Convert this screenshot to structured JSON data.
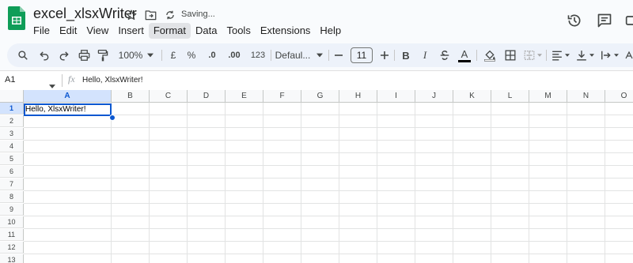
{
  "header": {
    "title": "excel_xlsxWriter",
    "status": "Saving...",
    "icons": [
      "star-icon",
      "move-to-folder-icon",
      "sync-icon",
      "history-icon",
      "comment-icon",
      "video-call-icon"
    ]
  },
  "menu": [
    "File",
    "Edit",
    "View",
    "Insert",
    "Format",
    "Data",
    "Tools",
    "Extensions",
    "Help"
  ],
  "menu_active": "Format",
  "toolbar": {
    "zoom": "100%",
    "currency": "£",
    "percent": "%",
    "decrease_decimal": ".0",
    "increase_decimal": ".00",
    "more_formats": "123",
    "font": "Defaul...",
    "font_size": "11",
    "bold": "B",
    "italic": "I",
    "text_color_letter": "A"
  },
  "formula_bar": {
    "name_box": "A1",
    "fx": "fx",
    "content": "Hello, XlsxWriter!"
  },
  "grid": {
    "columns": [
      "A",
      "B",
      "C",
      "D",
      "E",
      "F",
      "G",
      "H",
      "I",
      "J",
      "K",
      "L",
      "M",
      "N",
      "O"
    ],
    "rows": [
      "1",
      "2",
      "3",
      "4",
      "5",
      "6",
      "7",
      "8",
      "9",
      "10",
      "11",
      "12",
      "13"
    ],
    "selected_cell": "A1",
    "cells": {
      "A1": "Hello, XlsxWriter!"
    }
  },
  "colors": {
    "accent": "#0b57d0",
    "selection_header": "#d3e3fd",
    "toolbar_bg": "#edf2fa",
    "sheets_green": "#0f9d58"
  }
}
